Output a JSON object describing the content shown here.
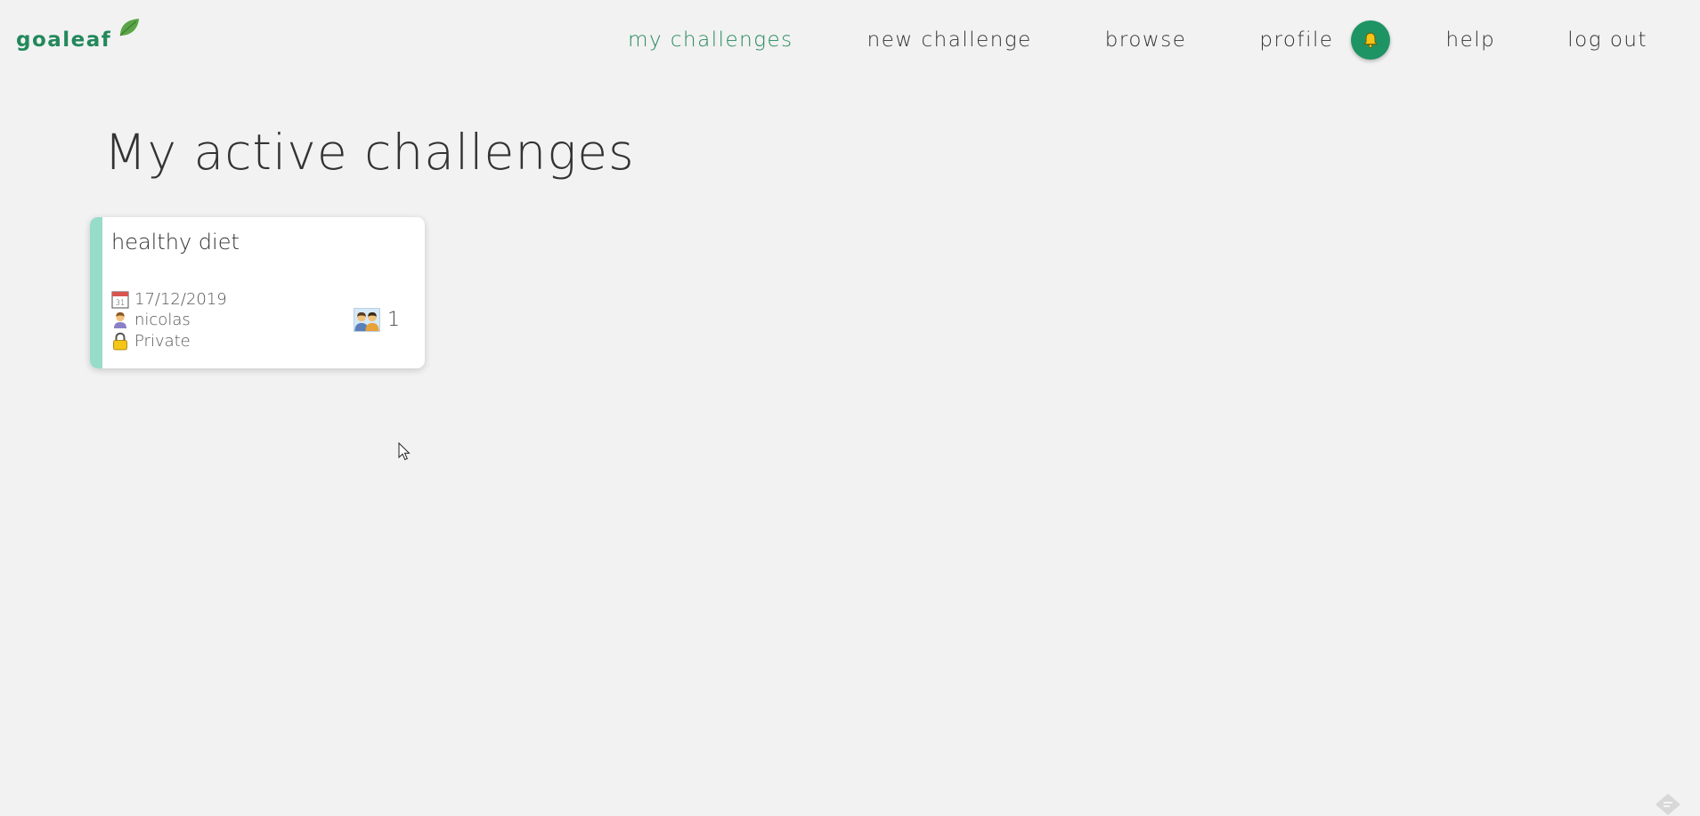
{
  "app": {
    "name": "goaleaf",
    "accent_color": "#23885b",
    "bell_color": "#1e9464"
  },
  "nav": {
    "items": [
      {
        "label": "my challenges",
        "active": true
      },
      {
        "label": "new challenge"
      },
      {
        "label": "browse"
      },
      {
        "label": "profile"
      },
      {
        "label": "help"
      },
      {
        "label": "log out"
      }
    ],
    "notification_icon": "bell-icon"
  },
  "main": {
    "title": "My active challenges",
    "challenges": [
      {
        "name": "healthy diet",
        "date": "17/12/2019",
        "owner": "nicolas",
        "privacy": "Private",
        "participants": "1",
        "stripe_color": "#97dcc8",
        "icons": {
          "date": "calendar-icon",
          "owner": "person-icon",
          "privacy": "lock-icon",
          "participants": "people-icon"
        }
      }
    ]
  }
}
